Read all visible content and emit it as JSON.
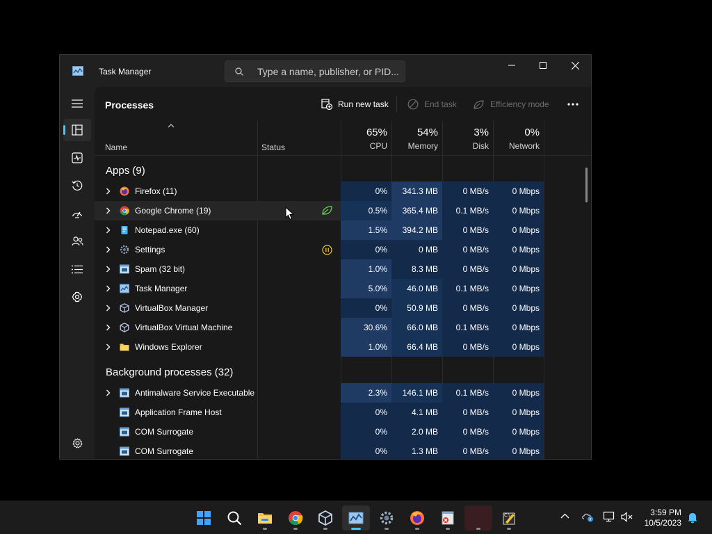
{
  "window": {
    "title": "Task Manager",
    "search_placeholder": "Type a name, publisher, or PID..."
  },
  "nav": [
    "processes-icon",
    "performance-icon",
    "app-history-icon",
    "startup-apps-icon",
    "users-icon",
    "details-icon",
    "services-icon",
    "settings-icon"
  ],
  "toolbar": {
    "page_title": "Processes",
    "run_new_task": "Run new task",
    "end_task": "End task",
    "efficiency_mode": "Efficiency mode"
  },
  "columns": {
    "name": "Name",
    "status": "Status",
    "cpu_pct": "65%",
    "cpu": "CPU",
    "memory_pct": "54%",
    "memory": "Memory",
    "disk_pct": "3%",
    "disk": "Disk",
    "network_pct": "0%",
    "network": "Network"
  },
  "groups": {
    "apps": "Apps (9)",
    "background": "Background processes (32)"
  },
  "apps": [
    {
      "name": "Firefox (11)",
      "cpu": "0%",
      "memory": "341.3 MB",
      "disk": "0 MB/s",
      "network": "0 Mbps",
      "icon": "firefox-icon"
    },
    {
      "name": "Google Chrome (19)",
      "cpu": "0.5%",
      "memory": "365.4 MB",
      "disk": "0.1 MB/s",
      "network": "0 Mbps",
      "icon": "chrome-icon",
      "status": "efficiency-leaf-icon"
    },
    {
      "name": "Notepad.exe (60)",
      "cpu": "1.5%",
      "memory": "394.2 MB",
      "disk": "0 MB/s",
      "network": "0 Mbps",
      "icon": "notepad-icon"
    },
    {
      "name": "Settings",
      "cpu": "0%",
      "memory": "0 MB",
      "disk": "0 MB/s",
      "network": "0 Mbps",
      "icon": "settings-gear-icon",
      "status": "suspended-pause-icon"
    },
    {
      "name": "Spam (32 bit)",
      "cpu": "1.0%",
      "memory": "8.3 MB",
      "disk": "0 MB/s",
      "network": "0 Mbps",
      "icon": "window-app-icon"
    },
    {
      "name": "Task Manager",
      "cpu": "5.0%",
      "memory": "46.0 MB",
      "disk": "0.1 MB/s",
      "network": "0 Mbps",
      "icon": "task-manager-icon"
    },
    {
      "name": "VirtualBox Manager",
      "cpu": "0%",
      "memory": "50.9 MB",
      "disk": "0 MB/s",
      "network": "0 Mbps",
      "icon": "virtualbox-icon"
    },
    {
      "name": "VirtualBox Virtual Machine",
      "cpu": "30.6%",
      "memory": "66.0 MB",
      "disk": "0.1 MB/s",
      "network": "0 Mbps",
      "icon": "virtualbox-icon"
    },
    {
      "name": "Windows Explorer",
      "cpu": "1.0%",
      "memory": "66.4 MB",
      "disk": "0 MB/s",
      "network": "0 Mbps",
      "icon": "folder-icon"
    }
  ],
  "background": [
    {
      "name": "Antimalware Service Executable",
      "cpu": "2.3%",
      "memory": "146.1 MB",
      "disk": "0.1 MB/s",
      "network": "0 Mbps",
      "icon": "window-app-icon",
      "expandable": true
    },
    {
      "name": "Application Frame Host",
      "cpu": "0%",
      "memory": "4.1 MB",
      "disk": "0 MB/s",
      "network": "0 Mbps",
      "icon": "window-app-icon"
    },
    {
      "name": "COM Surrogate",
      "cpu": "0%",
      "memory": "2.0 MB",
      "disk": "0 MB/s",
      "network": "0 Mbps",
      "icon": "window-app-icon"
    },
    {
      "name": "COM Surrogate",
      "cpu": "0%",
      "memory": "1.3 MB",
      "disk": "0 MB/s",
      "network": "0 Mbps",
      "icon": "window-app-icon"
    }
  ],
  "taskbar": {
    "apps": [
      "start-icon",
      "search-icon",
      "file-explorer-icon",
      "chrome-icon",
      "virtualbox-icon",
      "task-manager-icon",
      "settings-icon",
      "firefox-icon",
      "spam-app-icon",
      "blank-app-icon",
      "notepad-app-icon"
    ],
    "time": "3:59 PM",
    "date": "10/5/2023"
  },
  "colors": {
    "accent": "#4cc2ff",
    "heat_light": "#1f3a63",
    "heat_mid": "#173257",
    "heat_dark": "#142a4a"
  }
}
